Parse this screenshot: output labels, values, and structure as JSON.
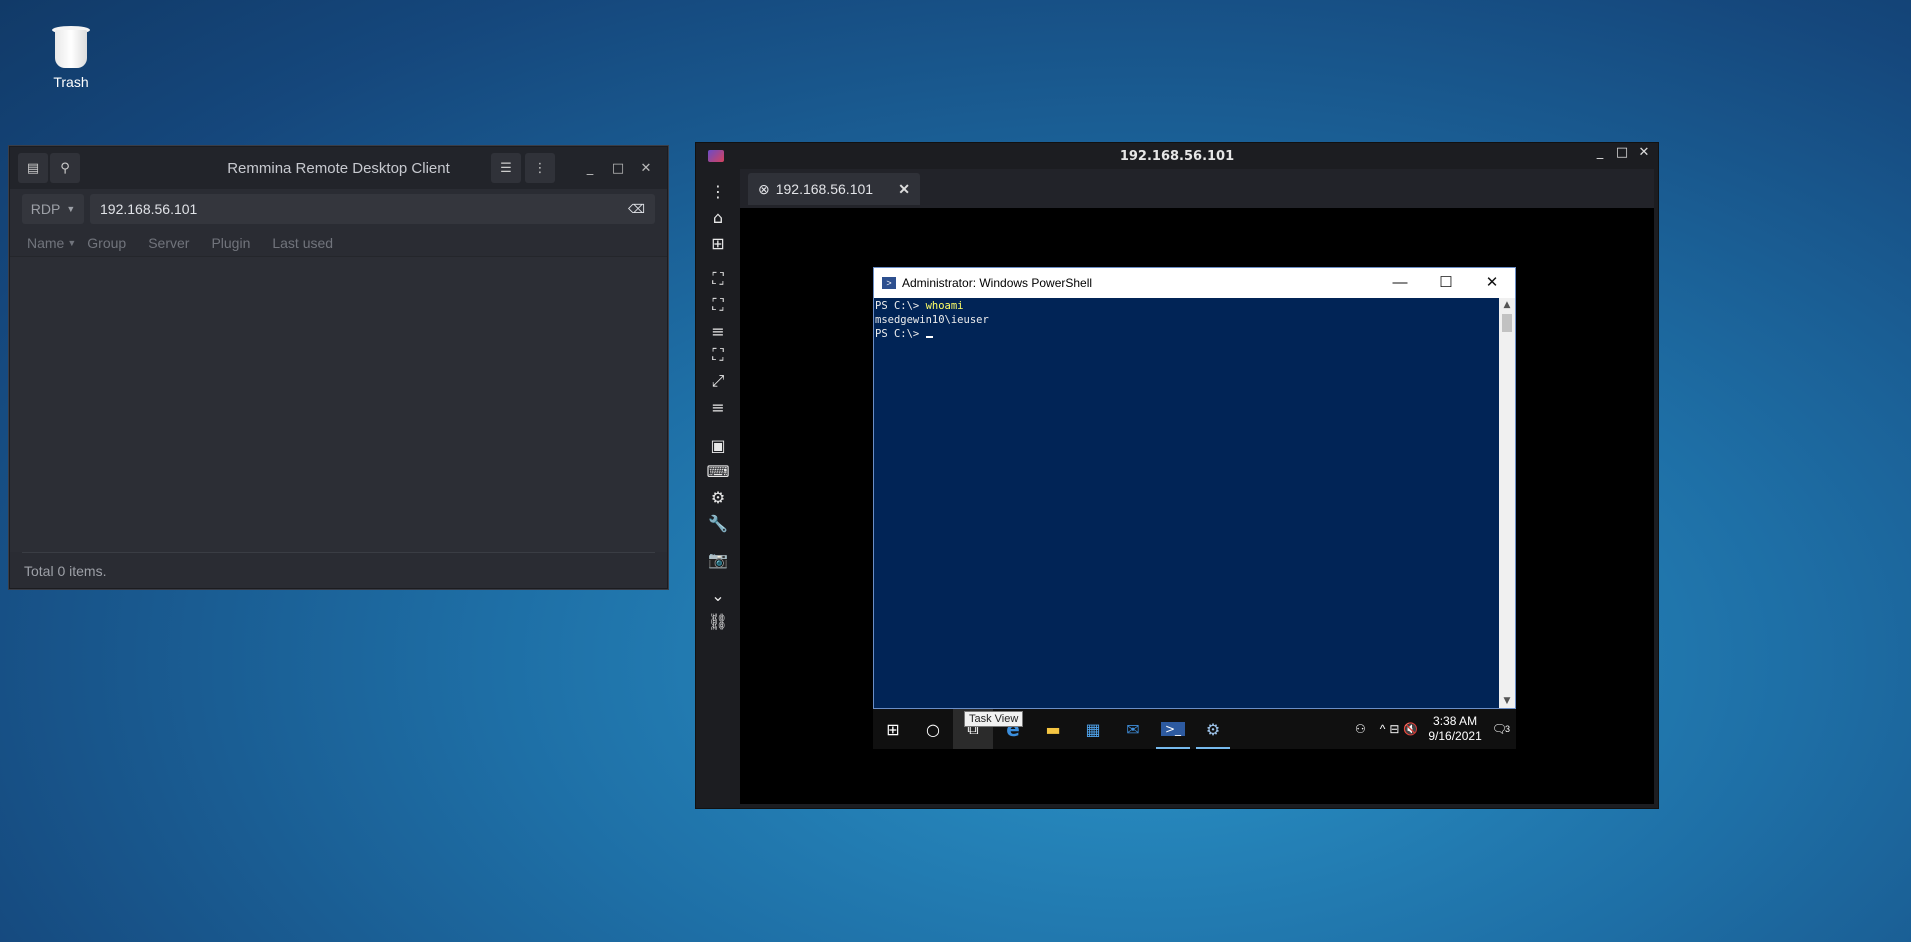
{
  "desktop": {
    "trash_label": "Trash"
  },
  "remmina": {
    "title": "Remmina Remote Desktop Client",
    "protocol": "RDP",
    "address": "192.168.56.101",
    "columns": [
      "Name",
      "Group",
      "Server",
      "Plugin",
      "Last used"
    ],
    "status": "Total 0 items."
  },
  "viewer": {
    "title": "192.168.56.101",
    "tab_label": "192.168.56.101"
  },
  "powershell": {
    "title": "Administrator: Windows PowerShell",
    "prompt1": "PS C:\\> ",
    "command1": "whoami",
    "output1": "msedgewin10\\ieuser",
    "prompt2": "PS C:\\> "
  },
  "windows_taskbar": {
    "tooltip": "Task View",
    "time": "3:38 AM",
    "date": "9/16/2021",
    "notification_count": "3"
  },
  "colors": {
    "powershell_bg": "#012456",
    "command_color": "#ffff66",
    "accent": "#76b9ed"
  }
}
